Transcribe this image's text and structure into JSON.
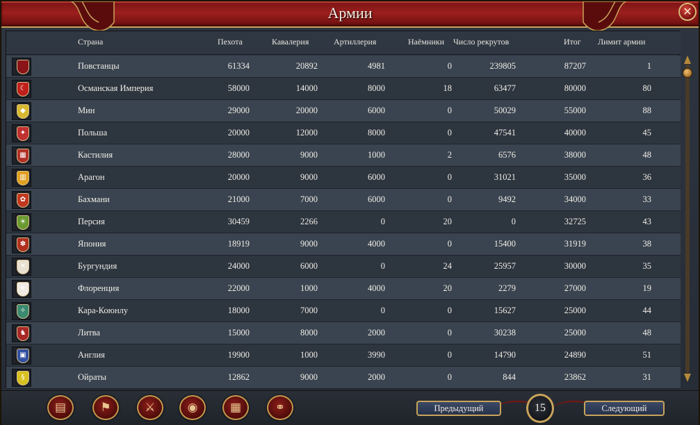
{
  "window": {
    "title": "Армии",
    "close_glyph": "✕"
  },
  "columns": [
    "Страна",
    "Пехота",
    "Кавалерия",
    "Артиллерия",
    "Наёмники",
    "Число рекрутов",
    "Итог",
    "Лимит армии"
  ],
  "rows": [
    {
      "country": "Повстанцы",
      "infantry": "61334",
      "cavalry": "20892",
      "artillery": "4981",
      "mercenaries": "0",
      "recruits": "239805",
      "total": "87207",
      "limit": "1",
      "shield_color": "#8a1418",
      "shield_glyph": "",
      "icon": "rebels-shield-icon"
    },
    {
      "country": "Османская Империя",
      "infantry": "58000",
      "cavalry": "14000",
      "artillery": "8000",
      "mercenaries": "18",
      "recruits": "63477",
      "total": "80000",
      "limit": "80",
      "shield_color": "#c0201c",
      "shield_glyph": "☾",
      "icon": "ottoman-shield-icon"
    },
    {
      "country": "Мин",
      "infantry": "29000",
      "cavalry": "20000",
      "artillery": "6000",
      "mercenaries": "0",
      "recruits": "50029",
      "total": "55000",
      "limit": "88",
      "shield_color": "#d8b830",
      "shield_glyph": "◆",
      "icon": "ming-shield-icon"
    },
    {
      "country": "Польша",
      "infantry": "20000",
      "cavalry": "12000",
      "artillery": "8000",
      "mercenaries": "0",
      "recruits": "47541",
      "total": "40000",
      "limit": "45",
      "shield_color": "#c03030",
      "shield_glyph": "✦",
      "icon": "poland-shield-icon"
    },
    {
      "country": "Кастилия",
      "infantry": "28000",
      "cavalry": "9000",
      "artillery": "1000",
      "mercenaries": "2",
      "recruits": "6576",
      "total": "38000",
      "limit": "48",
      "shield_color": "#b03028",
      "shield_glyph": "▦",
      "icon": "castile-shield-icon"
    },
    {
      "country": "Арагон",
      "infantry": "20000",
      "cavalry": "9000",
      "artillery": "6000",
      "mercenaries": "0",
      "recruits": "31021",
      "total": "35000",
      "limit": "36",
      "shield_color": "#e0a020",
      "shield_glyph": "▥",
      "icon": "aragon-shield-icon"
    },
    {
      "country": "Бахмани",
      "infantry": "21000",
      "cavalry": "7000",
      "artillery": "6000",
      "mercenaries": "0",
      "recruits": "9492",
      "total": "34000",
      "limit": "33",
      "shield_color": "#c03820",
      "shield_glyph": "✿",
      "icon": "bahmani-shield-icon"
    },
    {
      "country": "Персия",
      "infantry": "30459",
      "cavalry": "2266",
      "artillery": "0",
      "mercenaries": "20",
      "recruits": "0",
      "total": "32725",
      "limit": "43",
      "shield_color": "#6a9a30",
      "shield_glyph": "☀",
      "icon": "persia-shield-icon"
    },
    {
      "country": "Япония",
      "infantry": "18919",
      "cavalry": "9000",
      "artillery": "4000",
      "mercenaries": "0",
      "recruits": "15400",
      "total": "31919",
      "limit": "38",
      "shield_color": "#b03020",
      "shield_glyph": "✽",
      "icon": "japan-shield-icon"
    },
    {
      "country": "Бургундия",
      "infantry": "24000",
      "cavalry": "6000",
      "artillery": "0",
      "mercenaries": "24",
      "recruits": "25957",
      "total": "30000",
      "limit": "35",
      "shield_color": "#e8e0d0",
      "shield_glyph": "✕",
      "icon": "burgundy-shield-icon"
    },
    {
      "country": "Флоренция",
      "infantry": "22000",
      "cavalry": "1000",
      "artillery": "4000",
      "mercenaries": "20",
      "recruits": "2279",
      "total": "27000",
      "limit": "19",
      "shield_color": "#f0ece4",
      "shield_glyph": "⚜",
      "icon": "florence-shield-icon"
    },
    {
      "country": "Кара-Коюнлу",
      "infantry": "18000",
      "cavalry": "7000",
      "artillery": "0",
      "mercenaries": "0",
      "recruits": "15627",
      "total": "25000",
      "limit": "44",
      "shield_color": "#3a8a70",
      "shield_glyph": "✧",
      "icon": "qara-qoyunlu-shield-icon"
    },
    {
      "country": "Литва",
      "infantry": "15000",
      "cavalry": "8000",
      "artillery": "2000",
      "mercenaries": "0",
      "recruits": "30238",
      "total": "25000",
      "limit": "48",
      "shield_color": "#a82828",
      "shield_glyph": "♞",
      "icon": "lithuania-shield-icon"
    },
    {
      "country": "Англия",
      "infantry": "19900",
      "cavalry": "1000",
      "artillery": "3990",
      "mercenaries": "0",
      "recruits": "14790",
      "total": "24890",
      "limit": "51",
      "shield_color": "#3050a0",
      "shield_glyph": "▣",
      "icon": "england-shield-icon"
    },
    {
      "country": "Ойраты",
      "infantry": "12862",
      "cavalry": "9000",
      "artillery": "2000",
      "mercenaries": "0",
      "recruits": "844",
      "total": "23862",
      "limit": "31",
      "shield_color": "#d8c020",
      "shield_glyph": "§",
      "icon": "oirat-shield-icon"
    }
  ],
  "toolbar": {
    "buttons": [
      {
        "name": "ledger-button",
        "glyph": "▤"
      },
      {
        "name": "flag-button",
        "glyph": "⚑"
      },
      {
        "name": "swords-button",
        "glyph": "⚔"
      },
      {
        "name": "coins-button",
        "glyph": "◉"
      },
      {
        "name": "trade-button",
        "glyph": "▦"
      },
      {
        "name": "handshake-button",
        "glyph": "⚭"
      }
    ]
  },
  "pagination": {
    "prev_label": "Предыдущий",
    "page": "15",
    "next_label": "Следующий"
  }
}
